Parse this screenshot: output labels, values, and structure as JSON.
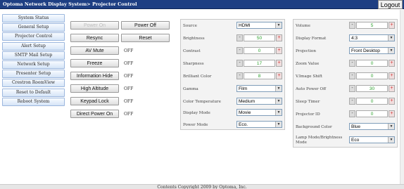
{
  "header": {
    "title": "Optoma Network Display System> Projector Control",
    "logout_label": "Logout"
  },
  "sidebar": {
    "items": [
      {
        "label": "System Status"
      },
      {
        "label": "General Setup"
      },
      {
        "label": "Projector Control"
      },
      {
        "label": "Alert Setup"
      },
      {
        "label": "SMTP Mail Setup"
      },
      {
        "label": "Network Setup"
      },
      {
        "label": "Presenter Setup"
      },
      {
        "label": "Crestron RoomView"
      },
      {
        "label": "Reset to Default"
      },
      {
        "label": "Reboot System"
      }
    ]
  },
  "controls": {
    "power_on": "Power On",
    "power_off": "Power Off",
    "resync": "Resync",
    "reset": "Reset",
    "av_mute": "AV Mute",
    "av_mute_state": "OFF",
    "freeze": "Freeze",
    "freeze_state": "OFF",
    "info_hide": "Information Hide",
    "info_hide_state": "OFF",
    "high_altitude": "High Altitude",
    "high_altitude_state": "OFF",
    "keypad_lock": "Keypad Lock",
    "keypad_lock_state": "OFF",
    "direct_power_on": "Direct Power On",
    "direct_power_on_state": "OFF"
  },
  "panel_mid": {
    "source": {
      "label": "Source",
      "value": "HDMI"
    },
    "brightness": {
      "label": "Brightness",
      "value": "50"
    },
    "contrast": {
      "label": "Contrast",
      "value": "0"
    },
    "sharpness": {
      "label": "Sharpness",
      "value": "17"
    },
    "brilliant_color": {
      "label": "Brilliant Color",
      "value": "8"
    },
    "gamma": {
      "label": "Gamma",
      "value": "Film"
    },
    "color_temperature": {
      "label": "Color Temperature",
      "value": "Medium"
    },
    "display_mode": {
      "label": "Display Mode",
      "value": "Movie"
    },
    "power_mode": {
      "label": "Power Mode",
      "value": "Eco."
    }
  },
  "panel_right": {
    "volume": {
      "label": "Volume",
      "value": "5"
    },
    "display_format": {
      "label": "Display Format",
      "value": "4:3"
    },
    "projection": {
      "label": "Projection",
      "value": "Front Desktop"
    },
    "zoom_value": {
      "label": "Zoom Value",
      "value": "0"
    },
    "v_image_shift": {
      "label": "V.Image Shift",
      "value": "0"
    },
    "auto_power_off": {
      "label": "Auto Power Off",
      "value": "30"
    },
    "sleep_timer": {
      "label": "Sleep Timer",
      "value": "0"
    },
    "projector_id": {
      "label": "Projector ID",
      "value": "0"
    },
    "background_color": {
      "label": "Background Color",
      "value": "Blue"
    },
    "lamp_mode": {
      "label": "Lamp Mode/Brightness Mode",
      "value": "Eco"
    }
  },
  "stepper_symbols": {
    "minus": "-",
    "plus": "+",
    "arrow": "▼"
  },
  "footer": {
    "text": "Contents Copyright 2009 by Optoma, Inc."
  }
}
